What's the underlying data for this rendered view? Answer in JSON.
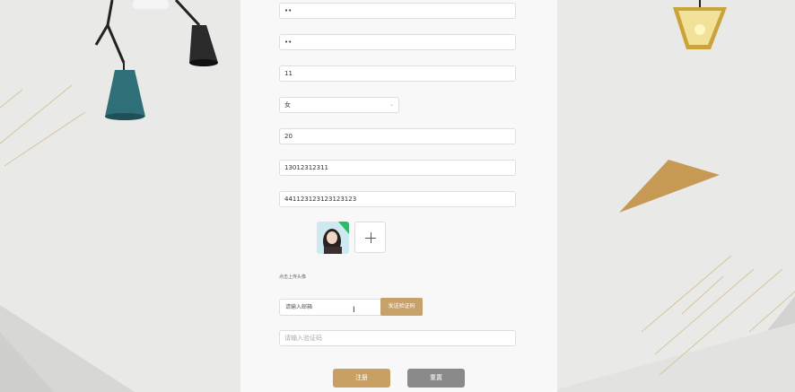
{
  "form": {
    "password": "••",
    "confirm_password": "••",
    "name": "11",
    "gender": "女",
    "age": "20",
    "phone": "13012312311",
    "id_number": "441123123123123123",
    "upload_hint": "点击上传头像",
    "email_placeholder": "请输入邮箱",
    "send_code_label": "发送验证码",
    "code_placeholder": "请输入验证码",
    "register_label": "注册",
    "reset_label": "重置"
  },
  "colors": {
    "gold": "#c9a064",
    "gray_button": "#8a8a8a",
    "background": "#e9e9e7"
  }
}
